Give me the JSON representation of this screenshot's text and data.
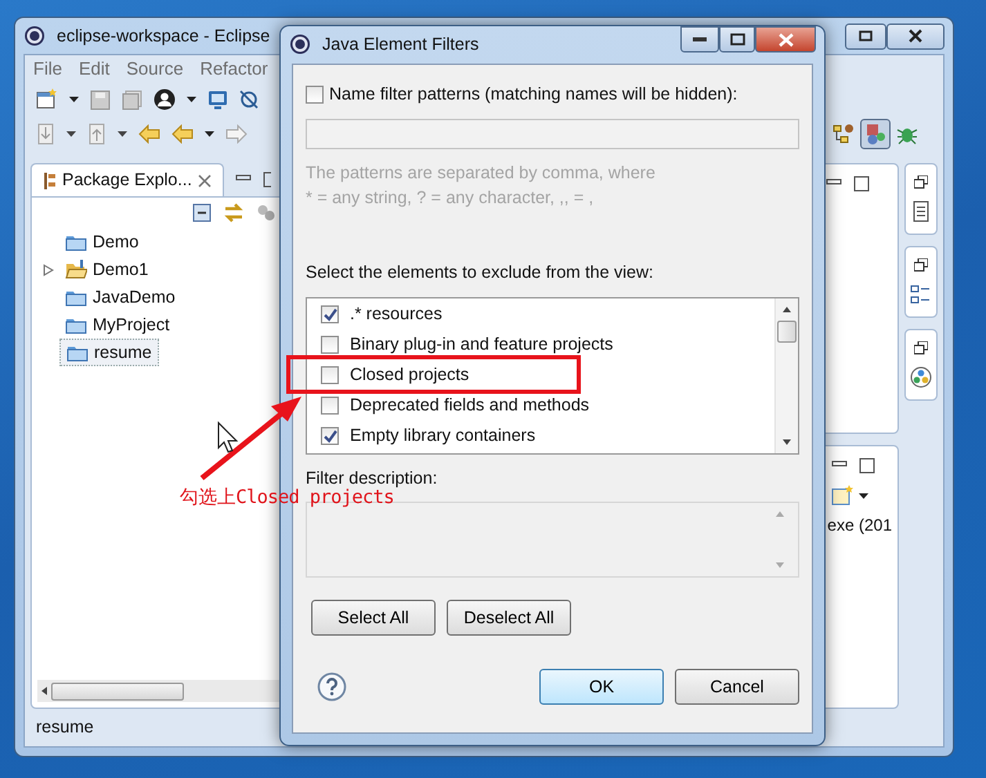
{
  "window": {
    "title": "eclipse-workspace - Eclipse"
  },
  "menu": [
    "File",
    "Edit",
    "Source",
    "Refactor"
  ],
  "package_explorer": {
    "title": "Package Explo...",
    "items": [
      {
        "label": "Demo",
        "kind": "closed",
        "expandable": false,
        "selected": false
      },
      {
        "label": "Demo1",
        "kind": "open",
        "expandable": true,
        "selected": false
      },
      {
        "label": "JavaDemo",
        "kind": "closed",
        "expandable": false,
        "selected": false
      },
      {
        "label": "MyProject",
        "kind": "closed",
        "expandable": false,
        "selected": false
      },
      {
        "label": "resume",
        "kind": "closed",
        "expandable": false,
        "selected": true
      }
    ]
  },
  "side_view": {
    "text": "exe (201"
  },
  "status_bar": "resume",
  "dialog": {
    "title": "Java Element Filters",
    "name_filter": {
      "label": "Name filter patterns (matching names will be hidden):",
      "checked": false
    },
    "hint": [
      "The patterns are separated by comma, where",
      "* = any string, ? = any character, ,, = ,"
    ],
    "exclude_label": "Select the elements to exclude from the view:",
    "filters": [
      {
        "label": ".* resources",
        "checked": true
      },
      {
        "label": "Binary plug-in and feature projects",
        "checked": false
      },
      {
        "label": "Closed projects",
        "checked": false
      },
      {
        "label": "Deprecated fields and methods",
        "checked": false
      },
      {
        "label": "Empty library containers",
        "checked": true
      }
    ],
    "description_label": "Filter description:",
    "buttons": [
      "Select All",
      "Deselect All"
    ],
    "ok": "OK",
    "cancel": "Cancel"
  },
  "annotation": {
    "text": "勾选上Closed projects"
  }
}
